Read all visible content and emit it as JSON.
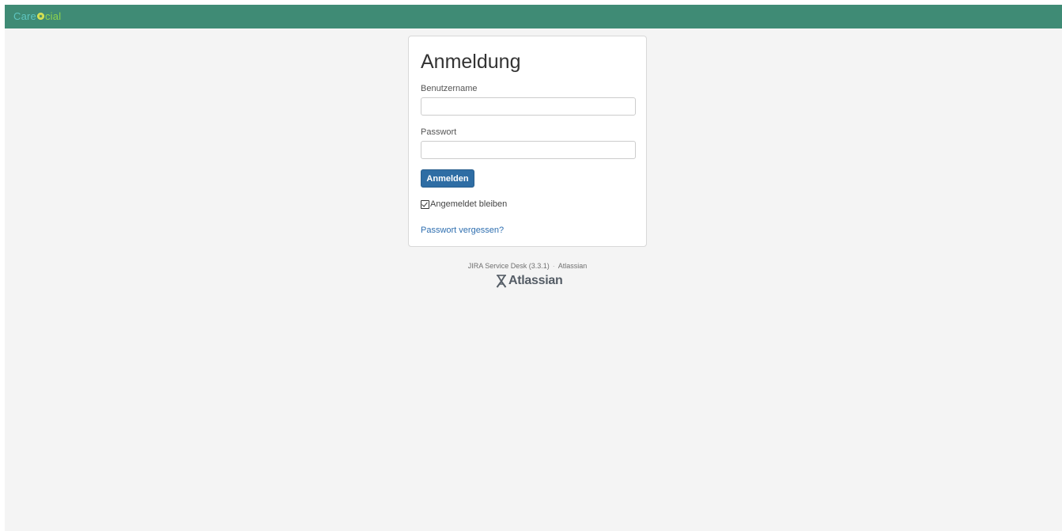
{
  "header": {
    "logo_part1": "Care",
    "logo_part2": "cial",
    "color": "#3f8b75"
  },
  "login": {
    "title": "Anmeldung",
    "username_label": "Benutzername",
    "username_value": "",
    "password_label": "Passwort",
    "password_value": "",
    "submit_label": "Anmelden",
    "remember_label": "Angemeldet bleiben",
    "remember_checked": true,
    "forgot_link": "Passwort vergessen?"
  },
  "footer": {
    "product": "JIRA Service Desk (3.3.1)",
    "separator": "·",
    "vendor": "Atlassian",
    "logo_text": "Atlassian"
  },
  "colors": {
    "button": "#2e6da4",
    "link": "#2f6fb0",
    "background": "#f4f4f4"
  }
}
